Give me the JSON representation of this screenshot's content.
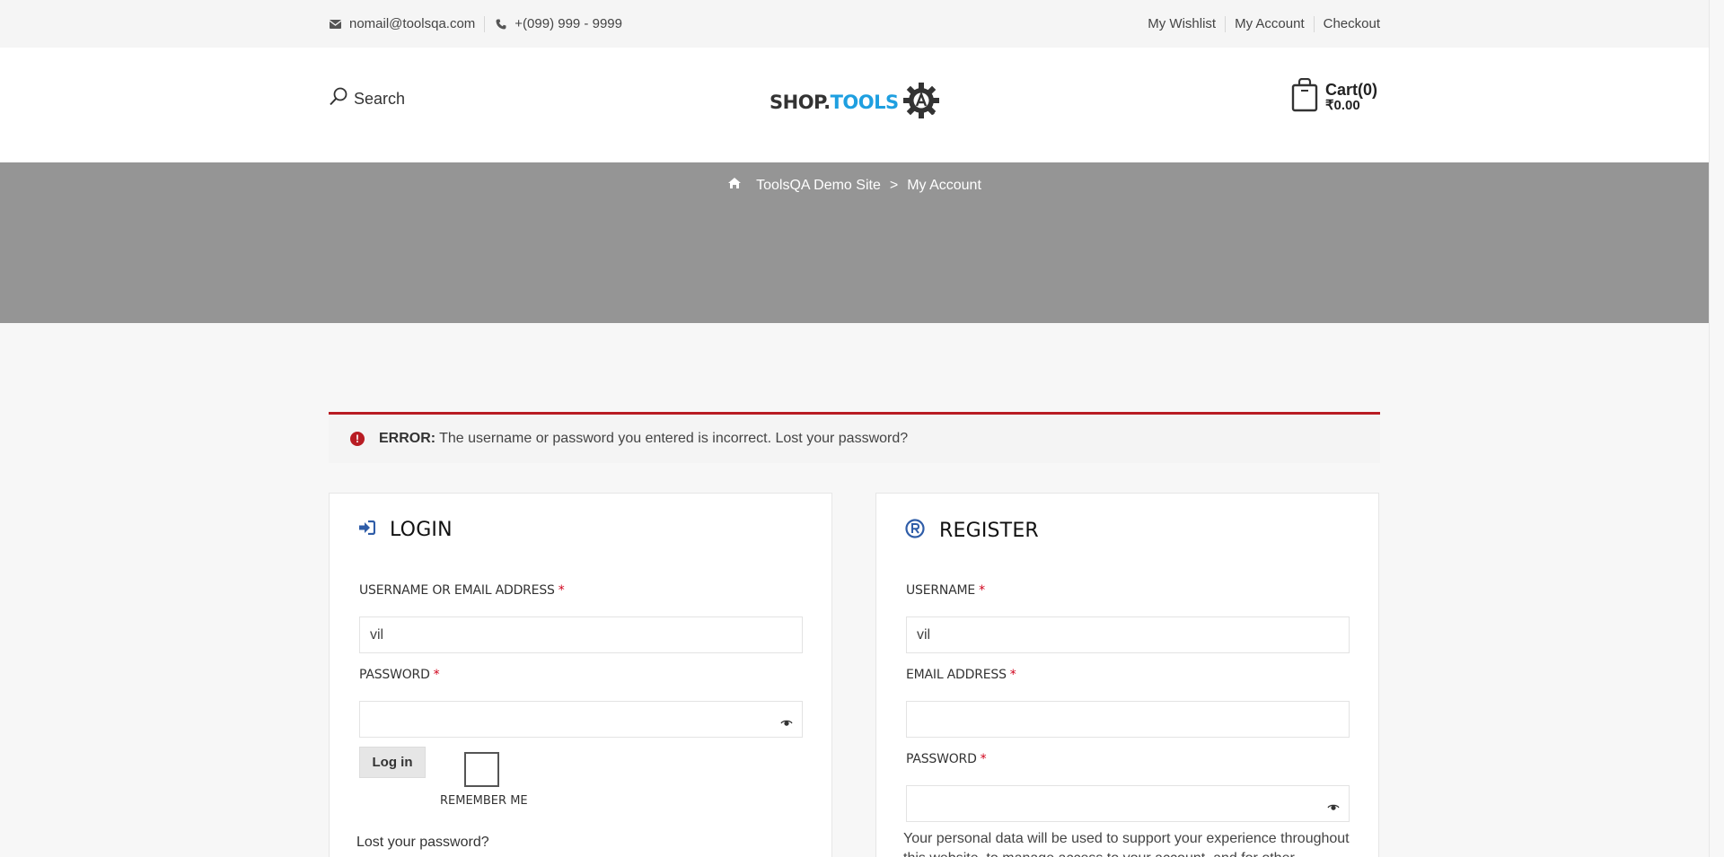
{
  "topbar": {
    "email": "nomail@toolsqa.com",
    "phone": "+(099) 999 - 9999",
    "links": [
      "My Wishlist",
      "My Account",
      "Checkout"
    ]
  },
  "header": {
    "search_label": "Search",
    "logo": {
      "part1": "SHOP.",
      "part2": "TOOLS"
    },
    "cart_title": "Cart(0)",
    "cart_total": "₹0.00"
  },
  "breadcrumb": {
    "home": "ToolsQA Demo Site",
    "separator": ">",
    "current": "My Account"
  },
  "error": {
    "prefix": "ERROR:",
    "message": "The username or password you entered is incorrect. Lost your password?"
  },
  "login": {
    "title": "LOGIN",
    "username_label": "USERNAME OR EMAIL ADDRESS",
    "username_value": "vil",
    "password_label": "PASSWORD",
    "password_value": "",
    "button": "Log in",
    "remember": "REMEMBER ME",
    "lost_password": "Lost your password?"
  },
  "register": {
    "title": "REGISTER",
    "username_label": "USERNAME",
    "username_value": "vil",
    "email_label": "EMAIL ADDRESS",
    "email_value": "",
    "password_label": "PASSWORD",
    "password_value": "",
    "privacy_text": "Your personal data will be used to support your experience throughout this website, to manage access to your account, and for other purposes"
  },
  "required_mark": "*",
  "colors": {
    "error_red": "#b81c23",
    "brand_blue": "#1e9fe0",
    "icon_blue": "#2f5da8",
    "banner_gray": "#959595"
  }
}
